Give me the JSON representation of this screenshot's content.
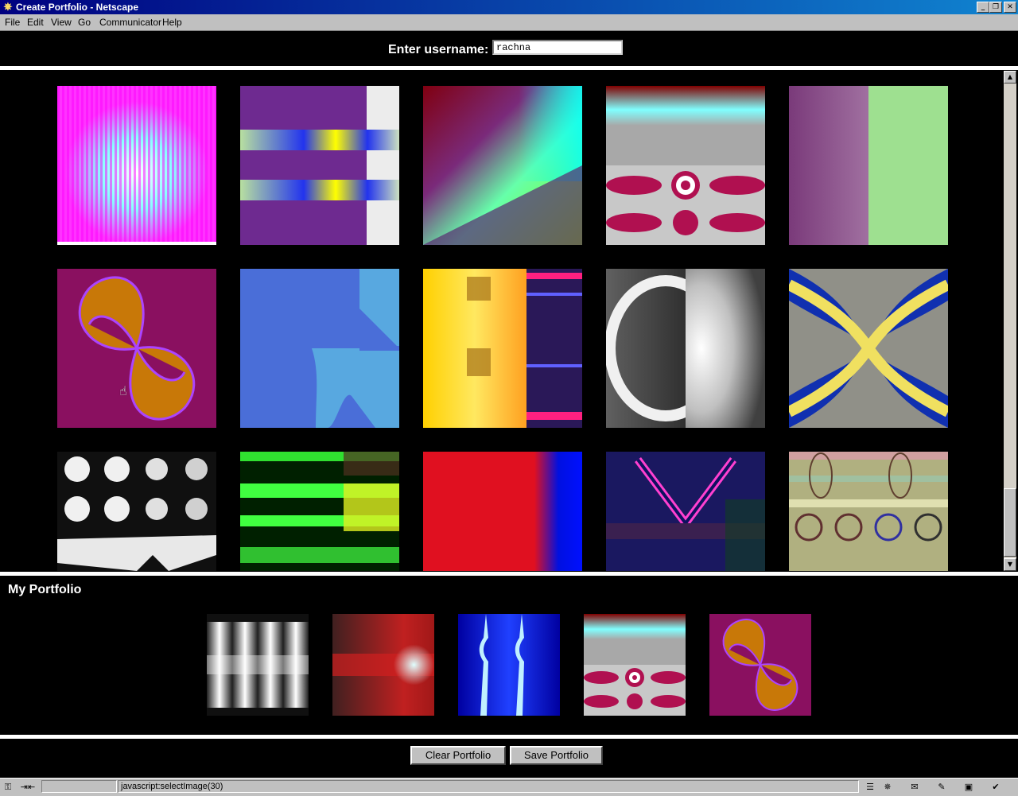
{
  "window": {
    "title": "Create Portfolio - Netscape",
    "minimize": "_",
    "restore": "❐",
    "close": "✕"
  },
  "menus": [
    "File",
    "Edit",
    "View",
    "Go",
    "Communicator",
    "Help"
  ],
  "user": {
    "label": "Enter username:",
    "value": "rachna"
  },
  "portfolio": {
    "title": "My Portfolio"
  },
  "buttons": {
    "clear": "Clear Portfolio",
    "save": "Save Portfolio"
  },
  "status": {
    "url": "javascript:selectImage(30)"
  },
  "icons": {
    "scroll_up": "▲",
    "scroll_down": "▼"
  }
}
